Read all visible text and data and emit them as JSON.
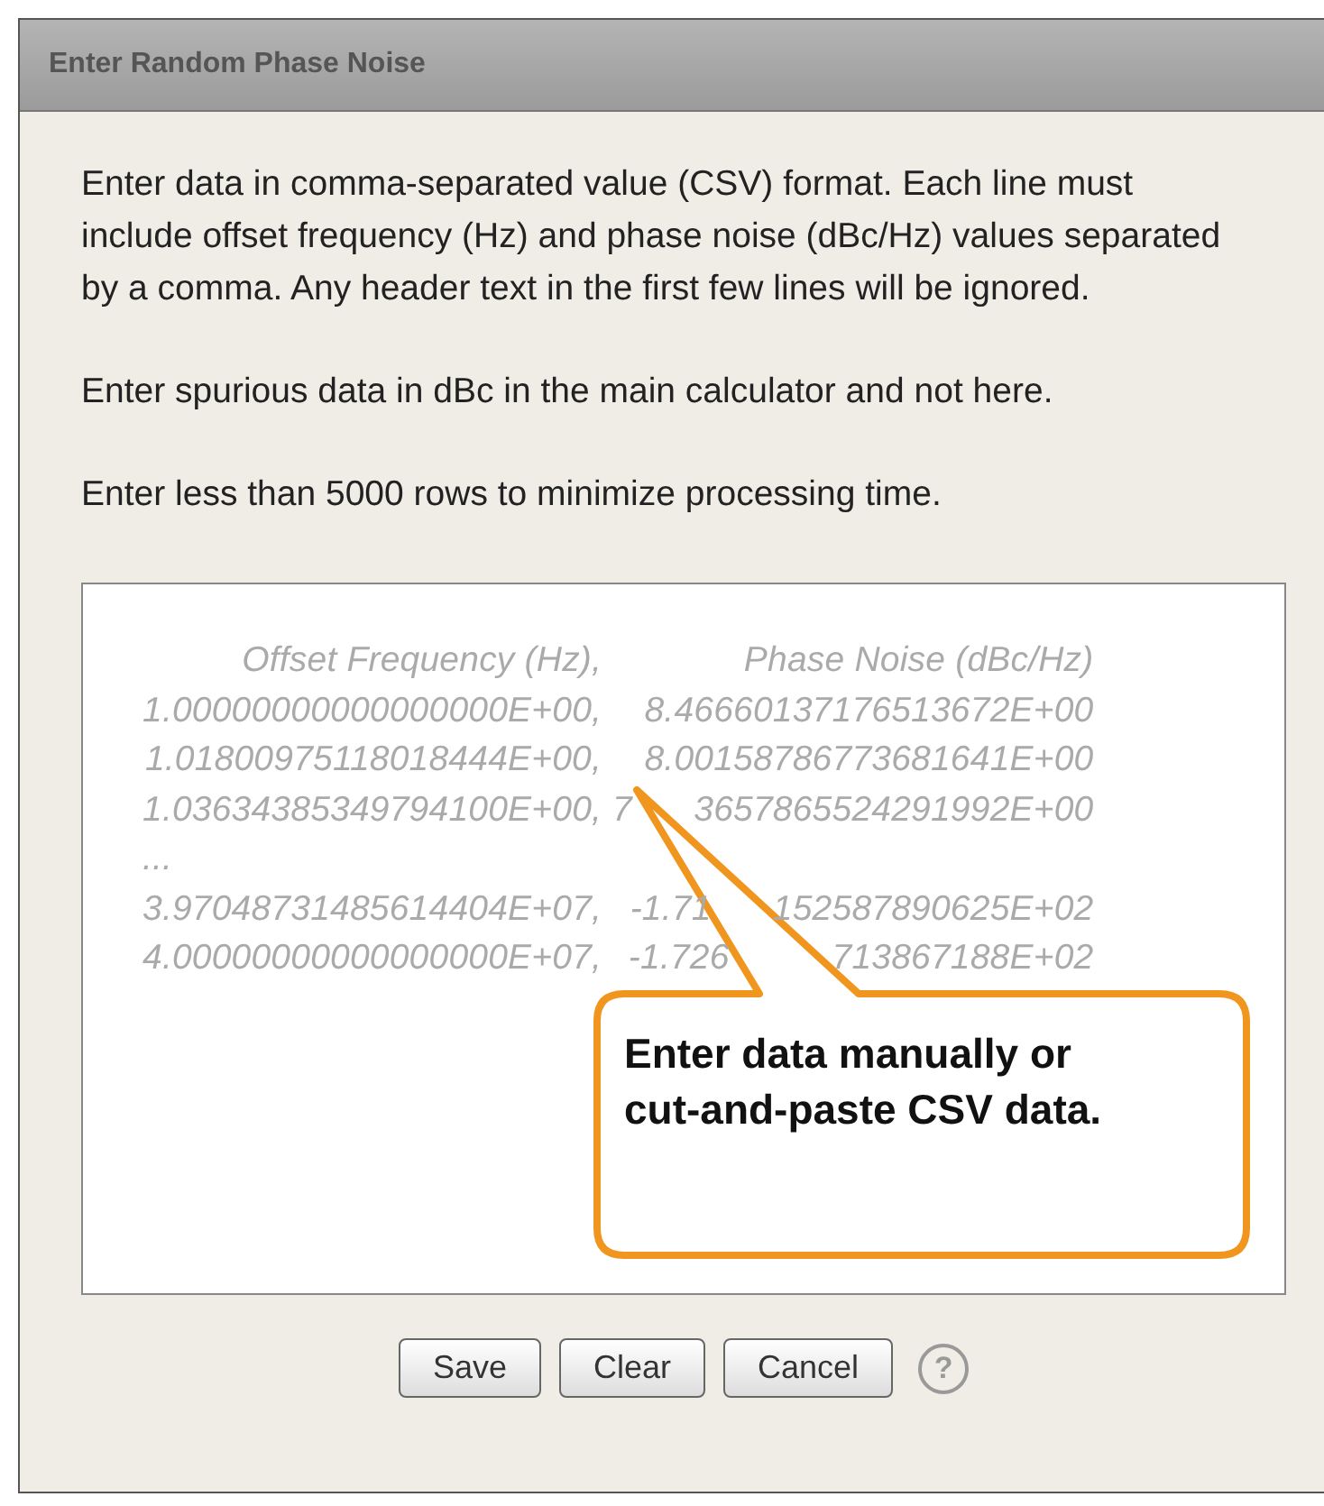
{
  "dialog": {
    "title": "Enter Random Phase Noise"
  },
  "paragraphs": [
    "Enter data in comma-separated value (CSV) format. Each line must include offset frequency (Hz) and phase noise (dBc/Hz) values separated by a comma. Any header text in the first few lines will be ignored.",
    "Enter spurious data in dBc in the main calculator and not here.",
    "Enter less than 5000 rows to minimize processing time."
  ],
  "csv_field": {
    "placeholder_rows": [
      {
        "offset": "Offset Frequency (Hz),",
        "noise": [
          "Phase Noise (dBc/Hz)"
        ]
      },
      {
        "offset": "1.00000000000000000E+00,",
        "noise": [
          "8.46660137176513672E+00"
        ]
      },
      {
        "offset": "1.01800975118018444E+00,",
        "noise": [
          "8.00158786773681641E+00"
        ]
      },
      {
        "offset": "1.03634385349794100E+00,",
        "noise": [
          "7",
          "3657865524291992E+00"
        ]
      },
      {
        "offset": "...",
        "noise": []
      },
      {
        "offset": "3.97048731485614404E+07,",
        "noise": [
          "-1.71",
          "152587890625E+02"
        ]
      },
      {
        "offset": "4.00000000000000000E+07,",
        "noise": [
          "-1.726",
          "713867188E+02"
        ]
      }
    ]
  },
  "callout": {
    "text": "Enter data manually or cut-and-paste CSV data."
  },
  "buttons": [
    "Save",
    "Clear",
    "Cancel"
  ],
  "help": {
    "label": "?"
  }
}
